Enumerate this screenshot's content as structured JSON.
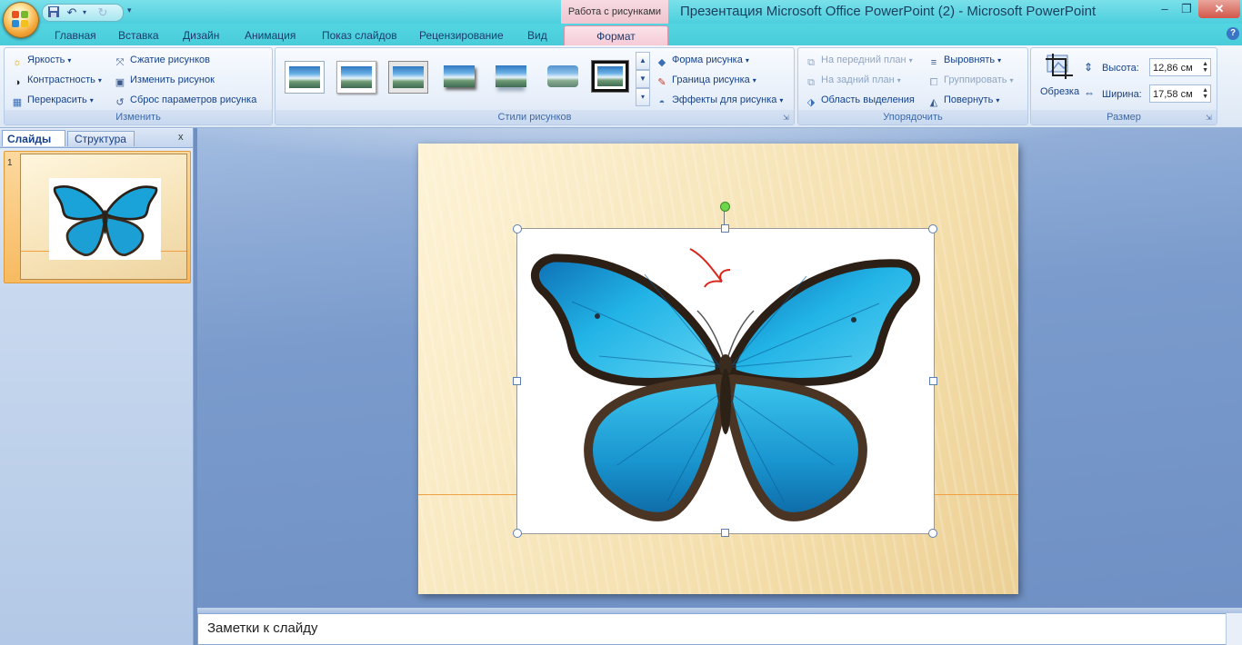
{
  "titlebar": {
    "window_title": "Презентация Microsoft Office PowerPoint (2)  -  Microsoft PowerPoint",
    "contextual_tab_header": "Работа с рисунками",
    "minimize": "–",
    "maximize": "❐",
    "close": "✕"
  },
  "tabs": [
    {
      "label": "Главная"
    },
    {
      "label": "Вставка"
    },
    {
      "label": "Дизайн"
    },
    {
      "label": "Анимация"
    },
    {
      "label": "Показ слайдов"
    },
    {
      "label": "Рецензирование"
    },
    {
      "label": "Вид"
    },
    {
      "label": "Формат",
      "active": true
    }
  ],
  "ribbon": {
    "adjust": {
      "label": "Изменить",
      "brightness": "Яркость",
      "contrast": "Контрастность",
      "recolor": "Перекрасить",
      "compress": "Сжатие рисунков",
      "change_picture": "Изменить рисунок",
      "reset_picture": "Сброс параметров рисунка"
    },
    "picture_styles": {
      "label": "Стили рисунков",
      "shape": "Форма рисунка",
      "border": "Граница рисунка",
      "effects": "Эффекты для рисунка"
    },
    "arrange": {
      "label": "Упорядочить",
      "bring_forward": "На передний план",
      "send_backward": "На задний план",
      "selection_pane": "Область выделения",
      "align": "Выровнять",
      "group": "Группировать",
      "rotate": "Повернуть"
    },
    "size": {
      "label": "Размер",
      "crop": "Обрезка",
      "height_label": "Высота:",
      "height_value": "12,86 см",
      "width_label": "Ширина:",
      "width_value": "17,58 см"
    }
  },
  "left_pane": {
    "tab_slides": "Слайды",
    "tab_outline": "Структура",
    "close": "x",
    "slide_number": "1"
  },
  "notes": {
    "placeholder": "Заметки к слайду"
  },
  "colors": {
    "titlebar": "#4ccfdd",
    "ribbon": "#dde8f5",
    "accent": "#15428b",
    "selected_thumb": "#f7ba5f",
    "butterfly": "#1aa3d8"
  }
}
